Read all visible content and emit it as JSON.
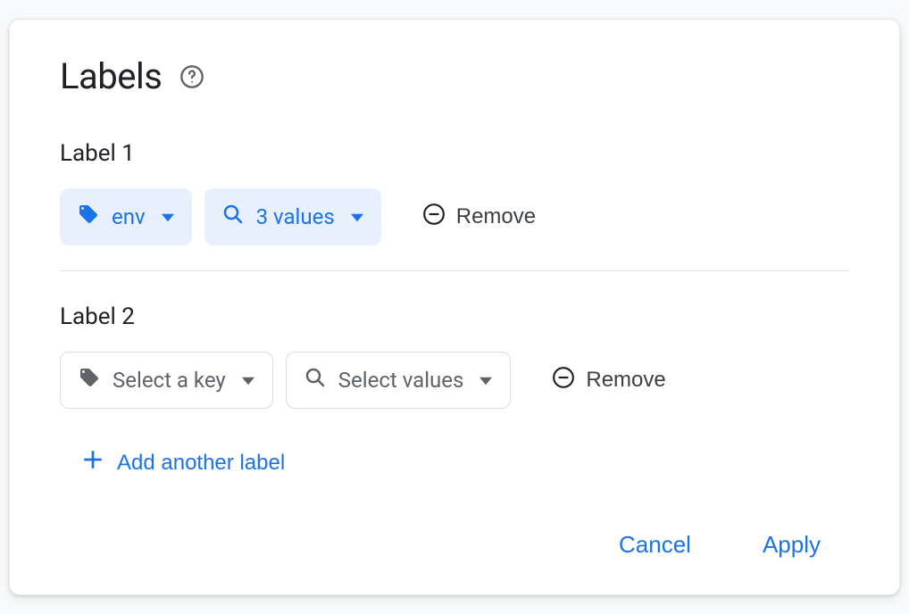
{
  "dialog": {
    "title": "Labels"
  },
  "labels": [
    {
      "heading": "Label 1",
      "key": "env",
      "values_display": "3 values",
      "filled": true
    },
    {
      "heading": "Label 2",
      "key": "Select a key",
      "values_display": "Select values",
      "filled": false
    }
  ],
  "actions": {
    "remove": "Remove",
    "add_another": "Add another label",
    "cancel": "Cancel",
    "apply": "Apply"
  }
}
